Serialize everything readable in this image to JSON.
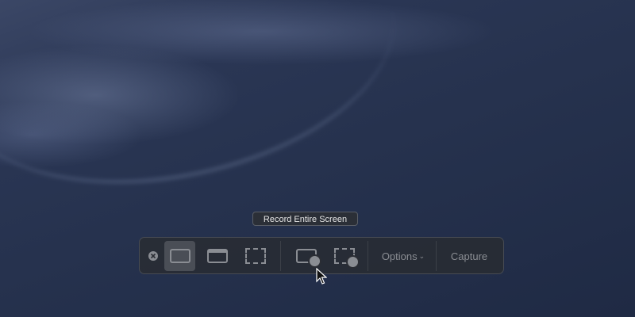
{
  "tooltip": "Record Entire Screen",
  "toolbar": {
    "options_label": "Options",
    "capture_label": "Capture"
  }
}
